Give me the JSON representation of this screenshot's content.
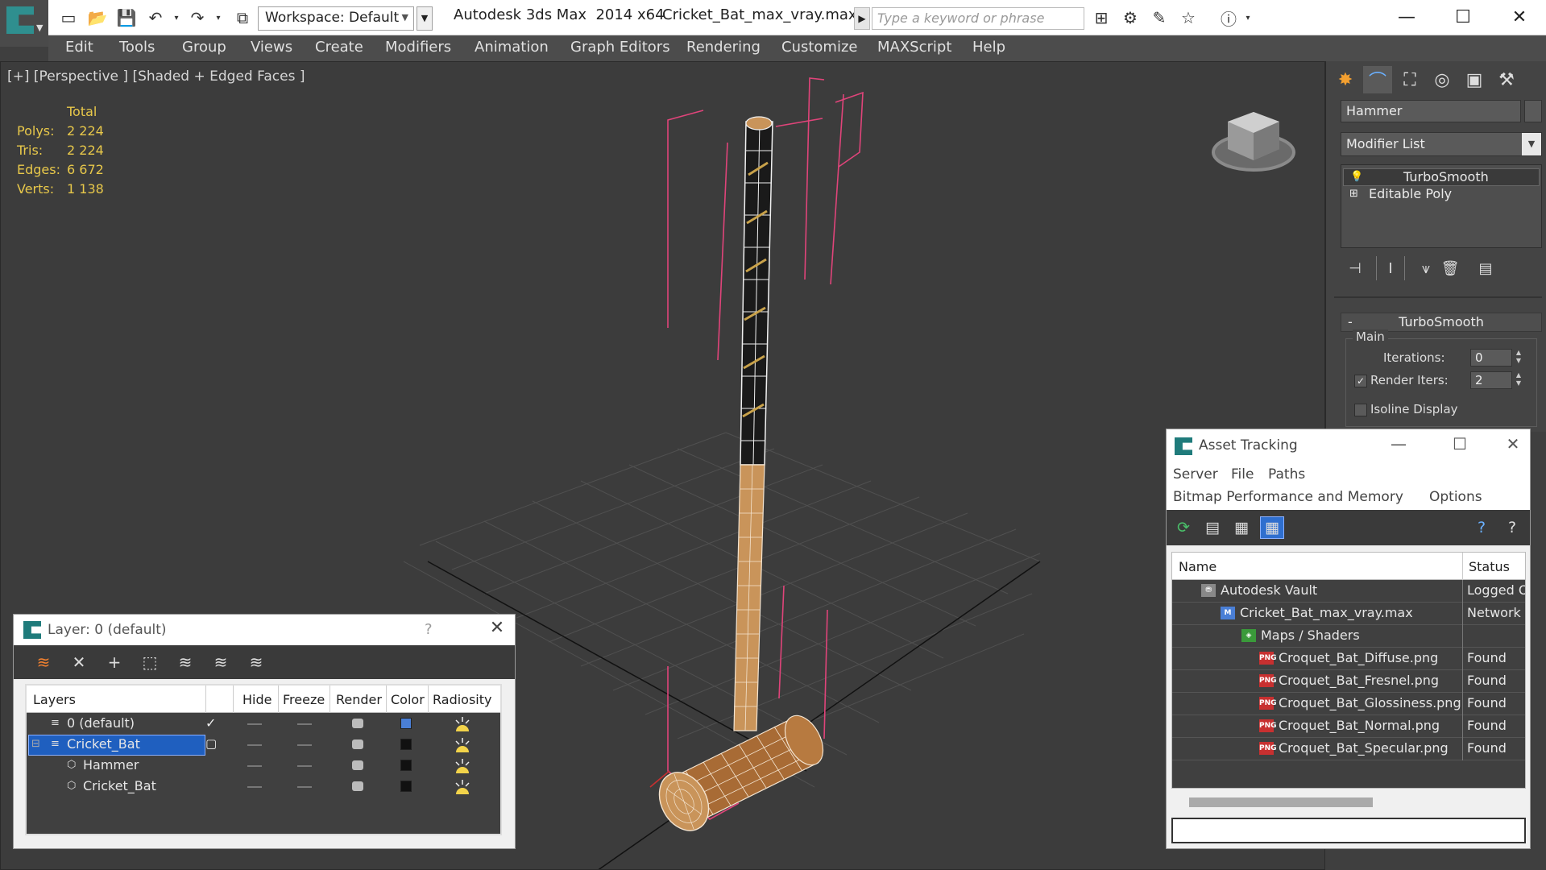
{
  "titlebar": {
    "workspace_value": "Workspace: Default",
    "app_title": "Autodesk 3ds Max  2014 x64",
    "file_title": "Cricket_Bat_max_vray.max",
    "search_placeholder": "Type a keyword or phrase"
  },
  "menubar": {
    "items": [
      "Edit",
      "Tools",
      "Group",
      "Views",
      "Create",
      "Modifiers",
      "Animation",
      "Graph Editors",
      "Rendering",
      "Customize",
      "MAXScript",
      "Help"
    ]
  },
  "viewport": {
    "label": "[+] [Perspective ] [Shaded + Edged Faces ]",
    "stats": {
      "header": "Total",
      "rows": [
        {
          "key": "Polys:",
          "value": "2 224"
        },
        {
          "key": "Tris:",
          "value": "2 224"
        },
        {
          "key": "Edges:",
          "value": "6 672"
        },
        {
          "key": "Verts:",
          "value": "1 138"
        }
      ]
    }
  },
  "command_panel": {
    "object_name": "Hammer",
    "modifier_list": "Modifier List",
    "stack": [
      "TurboSmooth",
      "Editable Poly"
    ],
    "rollout_title": "TurboSmooth",
    "group_main": "Main",
    "iterations_label": "Iterations:",
    "iterations_value": "0",
    "render_iters_label": "Render Iters:",
    "render_iters_value": "2",
    "render_iters_checked": true,
    "isoline_label": "Isoline Display",
    "rollout_minus": "-"
  },
  "layer_dialog": {
    "title": "Layer: 0 (default)",
    "help": "?",
    "columns": [
      "Layers",
      "Hide",
      "Freeze",
      "Render",
      "Color",
      "Radiosity"
    ],
    "rows": [
      {
        "name": "0 (default)",
        "color": "#4a7fd6",
        "current": true,
        "selected": false,
        "indent": 1
      },
      {
        "name": "Cricket_Bat",
        "color": "#111111",
        "current": false,
        "selected": true,
        "indent": 1
      },
      {
        "name": "Hammer",
        "color": "#111111",
        "current": false,
        "selected": false,
        "indent": 2
      },
      {
        "name": "Cricket_Bat",
        "color": "#111111",
        "current": false,
        "selected": false,
        "indent": 2
      }
    ]
  },
  "asset_dialog": {
    "title": "Asset Tracking",
    "menu_row1": [
      "Server",
      "File",
      "Paths"
    ],
    "menu_row2": [
      "Bitmap Performance and Memory",
      "Options"
    ],
    "columns": [
      "Name",
      "Status"
    ],
    "rows": [
      {
        "name": "Autodesk Vault",
        "status": "Logged Out",
        "icon": "vault",
        "indent": 0
      },
      {
        "name": "Cricket_Bat_max_vray.max",
        "status": "Network",
        "icon": "max",
        "indent": 1
      },
      {
        "name": "Maps / Shaders",
        "status": "",
        "icon": "maps",
        "indent": 2
      },
      {
        "name": "Croquet_Bat_Diffuse.png",
        "status": "Found",
        "icon": "png",
        "indent": 3
      },
      {
        "name": "Croquet_Bat_Fresnel.png",
        "status": "Found",
        "icon": "png",
        "indent": 3
      },
      {
        "name": "Croquet_Bat_Glossiness.png",
        "status": "Found",
        "icon": "png",
        "indent": 3
      },
      {
        "name": "Croquet_Bat_Normal.png",
        "status": "Found",
        "icon": "png",
        "indent": 3
      },
      {
        "name": "Croquet_Bat_Specular.png",
        "status": "Found",
        "icon": "png",
        "indent": 3
      }
    ],
    "png_badge": "PNG"
  },
  "colors": {
    "viewport_bg": "#3c3c3c",
    "stats_text": "#e8c84a",
    "selection_blue": "#1f5fbf",
    "wireframe_pink": "#e0447a",
    "handle_wood": "#c9945a"
  }
}
